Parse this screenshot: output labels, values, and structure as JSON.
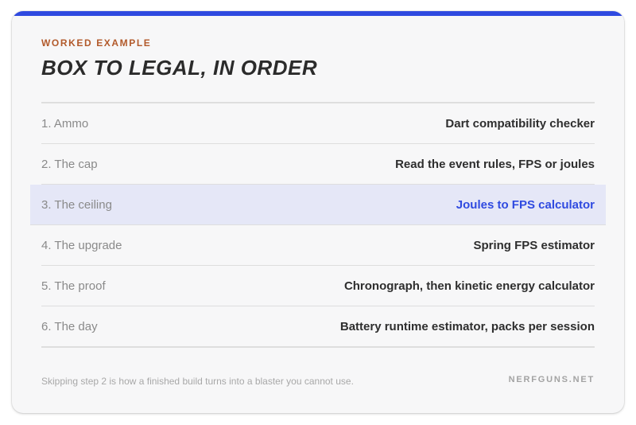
{
  "card": {
    "eyebrow": "WORKED EXAMPLE",
    "title": "BOX TO LEGAL, IN ORDER",
    "accent_color": "#2f4ae0",
    "eyebrow_color": "#b25a2b"
  },
  "steps": [
    {
      "label": "1. Ammo",
      "tool": "Dart compatibility checker",
      "highlighted": false
    },
    {
      "label": "2. The cap",
      "tool": "Read the event rules, FPS or joules",
      "highlighted": false
    },
    {
      "label": "3. The ceiling",
      "tool": "Joules to FPS calculator",
      "highlighted": true
    },
    {
      "label": "4. The upgrade",
      "tool": "Spring FPS estimator",
      "highlighted": false
    },
    {
      "label": "5. The proof",
      "tool": "Chronograph, then kinetic energy calculator",
      "highlighted": false
    },
    {
      "label": "6. The day",
      "tool": "Battery runtime estimator, packs per session",
      "highlighted": false
    }
  ],
  "footer": {
    "note": "Skipping step 2 is how a finished build turns into a blaster you cannot use.",
    "brand": "NERFGUNS.NET"
  }
}
